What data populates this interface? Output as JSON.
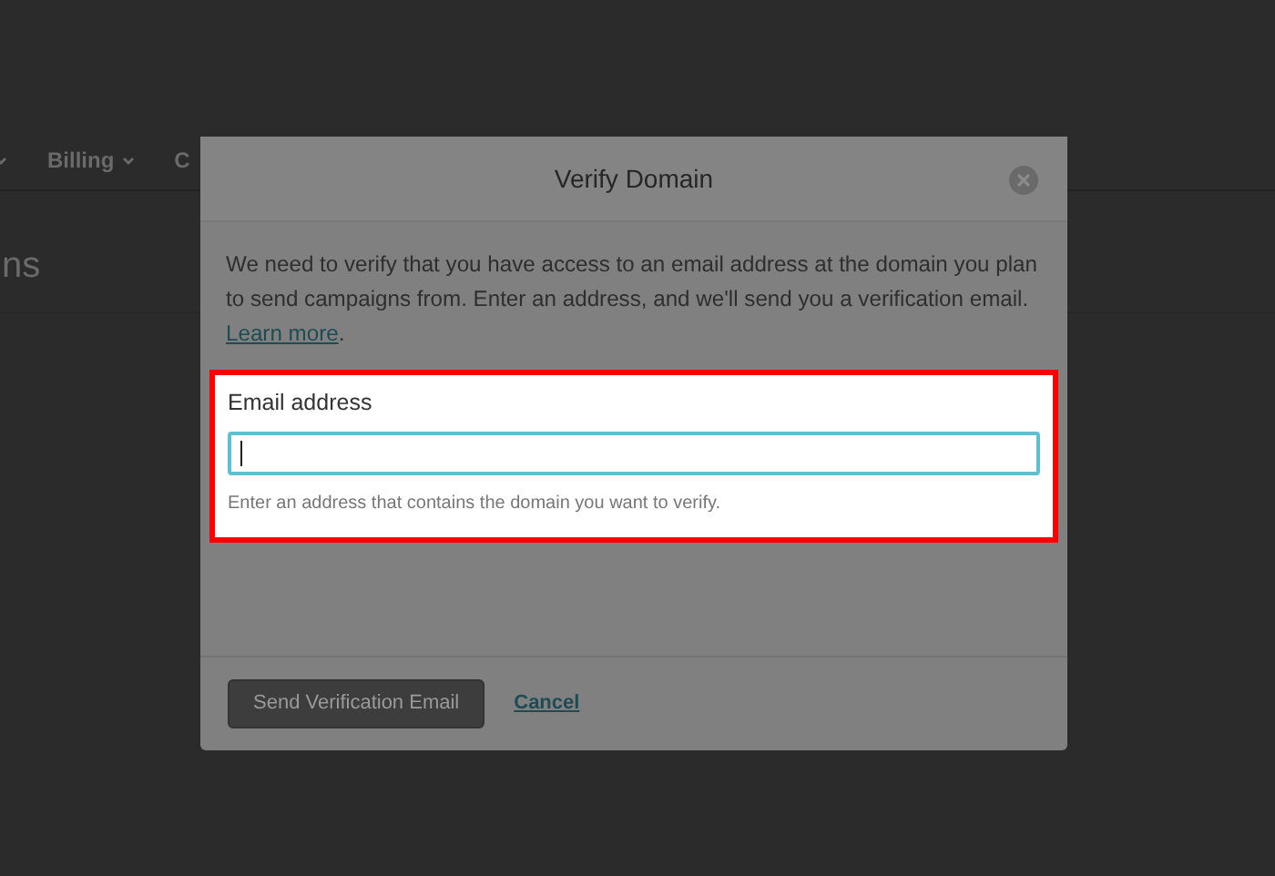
{
  "background_page": {
    "nav_items": [
      {
        "label": "Billing",
        "dropdown": true
      },
      {
        "label": "C",
        "dropdown": false
      }
    ],
    "heading": "ns"
  },
  "dialog": {
    "title": "Verify Domain",
    "description": "We need to verify that you have access to an email address at the domain you plan to send campaigns from. Enter an address, and we'll send you a verification email.",
    "learn_more_link": "Learn more",
    "description_end": ".",
    "field": {
      "label": "Email address",
      "focused": true,
      "hint": "Enter an address that contains the domain you want to verify.",
      "highlighted": true
    },
    "buttons": [
      {
        "label": "Send Verification Email",
        "kind": "primary"
      },
      {
        "label": "Cancel",
        "kind": "link"
      }
    ]
  }
}
